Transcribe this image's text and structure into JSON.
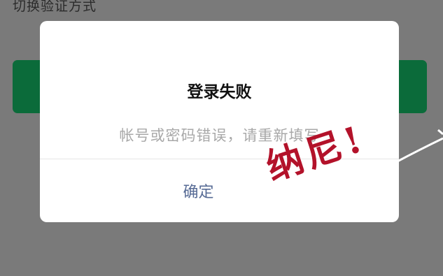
{
  "background": {
    "switch_login_label": "切换验证方式"
  },
  "dialog": {
    "title": "登录失败",
    "message": "帐号或密码错误，请重新填写",
    "confirm_label": "确定"
  },
  "overlay": {
    "sticker_text": "纳尼!",
    "sticker_color": "#b3122a"
  }
}
